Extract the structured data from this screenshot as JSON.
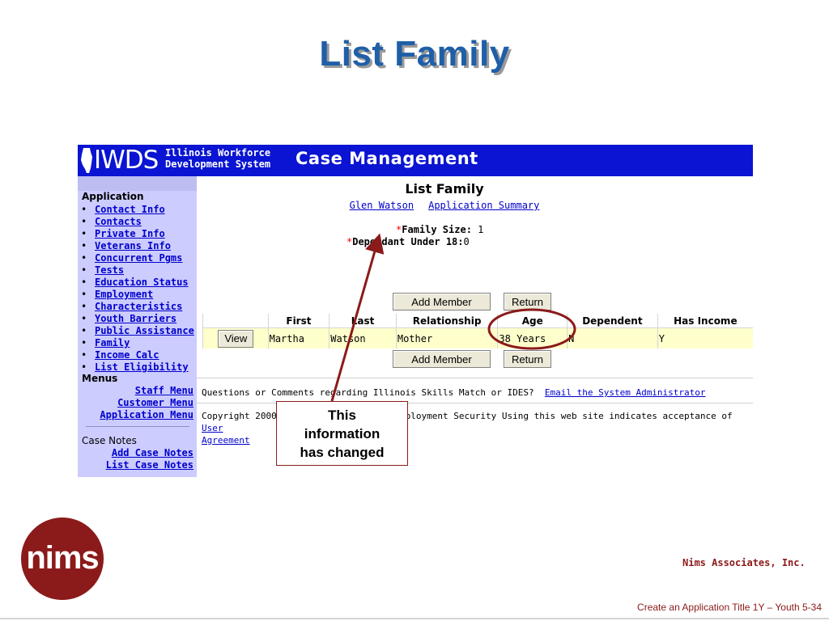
{
  "slide": {
    "title": "List Family",
    "company": "Nims Associates, Inc.",
    "footer": "Create an Application Title 1Y – Youth  5-34",
    "logo_text": "nims",
    "callout": [
      "This",
      "information",
      "has changed"
    ]
  },
  "banner": {
    "logo_text": "IWDS",
    "agency_line1": "Illinois Workforce",
    "agency_line2": "Development System",
    "app_title": "Case Management",
    "color": "#0a14d2"
  },
  "sidebar": {
    "section_application": "Application",
    "items": [
      {
        "label": "Contact Info"
      },
      {
        "label": "Contacts"
      },
      {
        "label": "Private Info"
      },
      {
        "label": "Veterans Info"
      },
      {
        "label": "Concurrent Pgms"
      },
      {
        "label": "Tests"
      },
      {
        "label": "Education Status"
      },
      {
        "label": "Employment"
      },
      {
        "label": "Characteristics"
      },
      {
        "label": "Youth Barriers"
      },
      {
        "label": "Public Assistance"
      },
      {
        "label": "Family"
      },
      {
        "label": "Income Calc"
      },
      {
        "label": "List Eligibility"
      }
    ],
    "section_menus": "Menus",
    "menus": [
      "Staff Menu",
      "Customer Menu",
      "Application Menu"
    ],
    "section_case_notes": "Case Notes",
    "case_notes": [
      "Add Case Notes",
      "List Case Notes"
    ],
    "bullet": "•"
  },
  "main": {
    "heading": "List Family",
    "person_link": "Glen Watson",
    "summary_link": "Application Summary",
    "required_mark": "*",
    "family_size_label": "Family Size:",
    "family_size_value": "1",
    "dependant_label": "Dependant Under 18:",
    "dependant_value": "0",
    "add_member_label": "Add Member",
    "return_label": "Return",
    "table": {
      "headers": [
        "",
        "First",
        "Last",
        "Relationship",
        "Age",
        "Dependent",
        "Has Income"
      ],
      "rows": [
        {
          "view_label": "View",
          "first": "Martha",
          "last": "Watson",
          "relationship": "Mother",
          "age": "38 Years",
          "dependent": "N",
          "has_income": "Y"
        }
      ]
    },
    "questions_text": "Questions or Comments regarding Illinois Skills Match or IDES?",
    "email_link": "Email the System Administrator",
    "copyright_text": "Copyright 2000 by Illinois Dept. of Employment Security Using this web site indicates acceptance of",
    "user_link": "User",
    "agreement_link": "Agreement"
  },
  "colors": {
    "title_blue": "#1f5fa8",
    "brand_red": "#8b1a1a",
    "sidebar_bg": "#ccccff",
    "row_bg": "#ffffcc"
  }
}
